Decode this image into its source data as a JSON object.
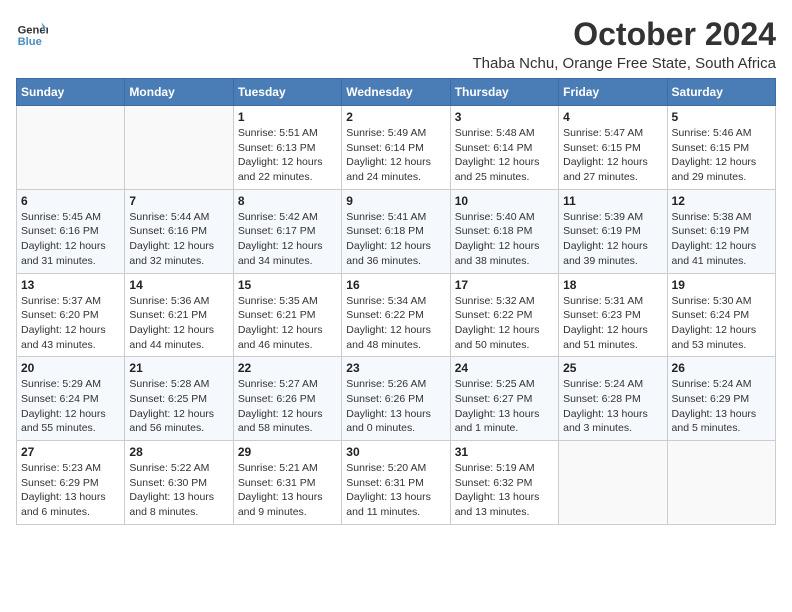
{
  "logo": {
    "text_general": "General",
    "text_blue": "Blue"
  },
  "header": {
    "month_year": "October 2024",
    "location": "Thaba Nchu, Orange Free State, South Africa"
  },
  "days_of_week": [
    "Sunday",
    "Monday",
    "Tuesday",
    "Wednesday",
    "Thursday",
    "Friday",
    "Saturday"
  ],
  "weeks": [
    [
      {
        "day": "",
        "sunrise": "",
        "sunset": "",
        "daylight": ""
      },
      {
        "day": "",
        "sunrise": "",
        "sunset": "",
        "daylight": ""
      },
      {
        "day": "1",
        "sunrise": "Sunrise: 5:51 AM",
        "sunset": "Sunset: 6:13 PM",
        "daylight": "Daylight: 12 hours and 22 minutes."
      },
      {
        "day": "2",
        "sunrise": "Sunrise: 5:49 AM",
        "sunset": "Sunset: 6:14 PM",
        "daylight": "Daylight: 12 hours and 24 minutes."
      },
      {
        "day": "3",
        "sunrise": "Sunrise: 5:48 AM",
        "sunset": "Sunset: 6:14 PM",
        "daylight": "Daylight: 12 hours and 25 minutes."
      },
      {
        "day": "4",
        "sunrise": "Sunrise: 5:47 AM",
        "sunset": "Sunset: 6:15 PM",
        "daylight": "Daylight: 12 hours and 27 minutes."
      },
      {
        "day": "5",
        "sunrise": "Sunrise: 5:46 AM",
        "sunset": "Sunset: 6:15 PM",
        "daylight": "Daylight: 12 hours and 29 minutes."
      }
    ],
    [
      {
        "day": "6",
        "sunrise": "Sunrise: 5:45 AM",
        "sunset": "Sunset: 6:16 PM",
        "daylight": "Daylight: 12 hours and 31 minutes."
      },
      {
        "day": "7",
        "sunrise": "Sunrise: 5:44 AM",
        "sunset": "Sunset: 6:16 PM",
        "daylight": "Daylight: 12 hours and 32 minutes."
      },
      {
        "day": "8",
        "sunrise": "Sunrise: 5:42 AM",
        "sunset": "Sunset: 6:17 PM",
        "daylight": "Daylight: 12 hours and 34 minutes."
      },
      {
        "day": "9",
        "sunrise": "Sunrise: 5:41 AM",
        "sunset": "Sunset: 6:18 PM",
        "daylight": "Daylight: 12 hours and 36 minutes."
      },
      {
        "day": "10",
        "sunrise": "Sunrise: 5:40 AM",
        "sunset": "Sunset: 6:18 PM",
        "daylight": "Daylight: 12 hours and 38 minutes."
      },
      {
        "day": "11",
        "sunrise": "Sunrise: 5:39 AM",
        "sunset": "Sunset: 6:19 PM",
        "daylight": "Daylight: 12 hours and 39 minutes."
      },
      {
        "day": "12",
        "sunrise": "Sunrise: 5:38 AM",
        "sunset": "Sunset: 6:19 PM",
        "daylight": "Daylight: 12 hours and 41 minutes."
      }
    ],
    [
      {
        "day": "13",
        "sunrise": "Sunrise: 5:37 AM",
        "sunset": "Sunset: 6:20 PM",
        "daylight": "Daylight: 12 hours and 43 minutes."
      },
      {
        "day": "14",
        "sunrise": "Sunrise: 5:36 AM",
        "sunset": "Sunset: 6:21 PM",
        "daylight": "Daylight: 12 hours and 44 minutes."
      },
      {
        "day": "15",
        "sunrise": "Sunrise: 5:35 AM",
        "sunset": "Sunset: 6:21 PM",
        "daylight": "Daylight: 12 hours and 46 minutes."
      },
      {
        "day": "16",
        "sunrise": "Sunrise: 5:34 AM",
        "sunset": "Sunset: 6:22 PM",
        "daylight": "Daylight: 12 hours and 48 minutes."
      },
      {
        "day": "17",
        "sunrise": "Sunrise: 5:32 AM",
        "sunset": "Sunset: 6:22 PM",
        "daylight": "Daylight: 12 hours and 50 minutes."
      },
      {
        "day": "18",
        "sunrise": "Sunrise: 5:31 AM",
        "sunset": "Sunset: 6:23 PM",
        "daylight": "Daylight: 12 hours and 51 minutes."
      },
      {
        "day": "19",
        "sunrise": "Sunrise: 5:30 AM",
        "sunset": "Sunset: 6:24 PM",
        "daylight": "Daylight: 12 hours and 53 minutes."
      }
    ],
    [
      {
        "day": "20",
        "sunrise": "Sunrise: 5:29 AM",
        "sunset": "Sunset: 6:24 PM",
        "daylight": "Daylight: 12 hours and 55 minutes."
      },
      {
        "day": "21",
        "sunrise": "Sunrise: 5:28 AM",
        "sunset": "Sunset: 6:25 PM",
        "daylight": "Daylight: 12 hours and 56 minutes."
      },
      {
        "day": "22",
        "sunrise": "Sunrise: 5:27 AM",
        "sunset": "Sunset: 6:26 PM",
        "daylight": "Daylight: 12 hours and 58 minutes."
      },
      {
        "day": "23",
        "sunrise": "Sunrise: 5:26 AM",
        "sunset": "Sunset: 6:26 PM",
        "daylight": "Daylight: 13 hours and 0 minutes."
      },
      {
        "day": "24",
        "sunrise": "Sunrise: 5:25 AM",
        "sunset": "Sunset: 6:27 PM",
        "daylight": "Daylight: 13 hours and 1 minute."
      },
      {
        "day": "25",
        "sunrise": "Sunrise: 5:24 AM",
        "sunset": "Sunset: 6:28 PM",
        "daylight": "Daylight: 13 hours and 3 minutes."
      },
      {
        "day": "26",
        "sunrise": "Sunrise: 5:24 AM",
        "sunset": "Sunset: 6:29 PM",
        "daylight": "Daylight: 13 hours and 5 minutes."
      }
    ],
    [
      {
        "day": "27",
        "sunrise": "Sunrise: 5:23 AM",
        "sunset": "Sunset: 6:29 PM",
        "daylight": "Daylight: 13 hours and 6 minutes."
      },
      {
        "day": "28",
        "sunrise": "Sunrise: 5:22 AM",
        "sunset": "Sunset: 6:30 PM",
        "daylight": "Daylight: 13 hours and 8 minutes."
      },
      {
        "day": "29",
        "sunrise": "Sunrise: 5:21 AM",
        "sunset": "Sunset: 6:31 PM",
        "daylight": "Daylight: 13 hours and 9 minutes."
      },
      {
        "day": "30",
        "sunrise": "Sunrise: 5:20 AM",
        "sunset": "Sunset: 6:31 PM",
        "daylight": "Daylight: 13 hours and 11 minutes."
      },
      {
        "day": "31",
        "sunrise": "Sunrise: 5:19 AM",
        "sunset": "Sunset: 6:32 PM",
        "daylight": "Daylight: 13 hours and 13 minutes."
      },
      {
        "day": "",
        "sunrise": "",
        "sunset": "",
        "daylight": ""
      },
      {
        "day": "",
        "sunrise": "",
        "sunset": "",
        "daylight": ""
      }
    ]
  ]
}
